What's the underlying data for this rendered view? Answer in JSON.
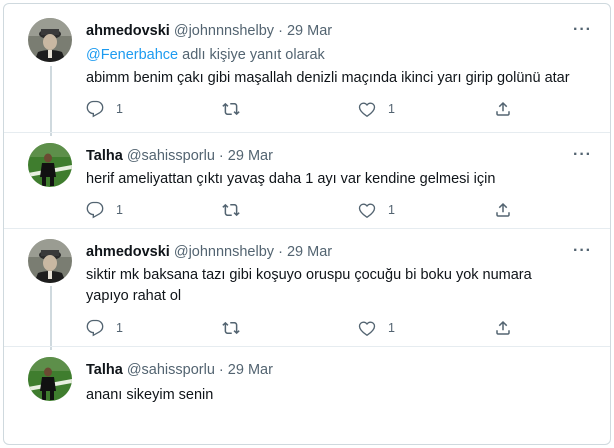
{
  "tweets": [
    {
      "name": "ahmedovski",
      "handle": "@johnnnshelby",
      "dot": "·",
      "date": "29 Mar",
      "reply_mention": "@Fenerbahce",
      "reply_suffix": " adlı kişiye yanıt olarak",
      "text": "abimm benim çakı gibi maşallah denizli maçında ikinci yarı girip golünü atar",
      "reply_count": "1",
      "retweet_count": "",
      "like_count": "1"
    },
    {
      "name": "Talha",
      "handle": "@sahissporlu",
      "dot": "·",
      "date": "29 Mar",
      "text": "herif ameliyattan çıktı yavaş daha 1 ayı var kendine gelmesi için",
      "reply_count": "1",
      "retweet_count": "",
      "like_count": "1"
    },
    {
      "name": "ahmedovski",
      "handle": "@johnnnshelby",
      "dot": "·",
      "date": "29 Mar",
      "text": "siktir mk baksana tazı gibi koşuyo oruspu çocuğu bi boku yok numara yapıyo rahat ol",
      "reply_count": "1",
      "retweet_count": "",
      "like_count": "1"
    },
    {
      "name": "Talha",
      "handle": "@sahissporlu",
      "dot": "·",
      "date": "29 Mar",
      "text": "ananı sikeyim senin"
    }
  ],
  "icons": {
    "more": "more-icon",
    "reply": "reply-icon",
    "retweet": "retweet-icon",
    "like": "like-icon",
    "share": "share-icon"
  },
  "colors": {
    "link": "#1d9bf0",
    "secondary": "#536471",
    "primary": "#0f1419",
    "border": "#cfd9de"
  }
}
